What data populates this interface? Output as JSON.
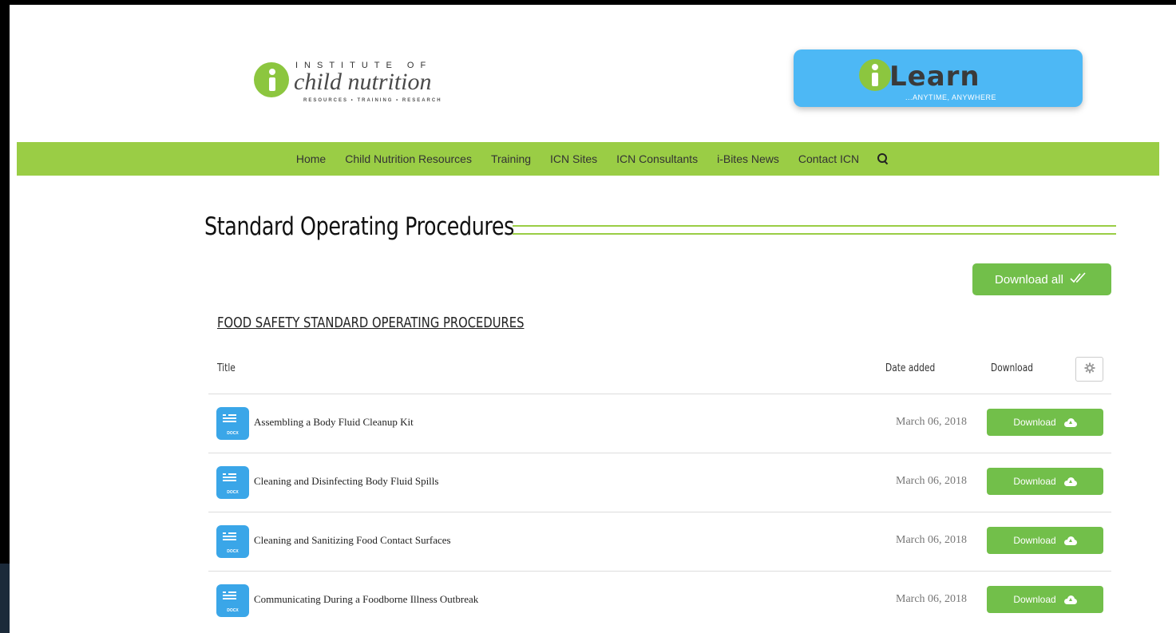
{
  "header": {
    "logo": {
      "top_text": "INSTITUTE OF",
      "script_text": "child nutrition",
      "tagline": "RESOURCES • TRAINING • RESEARCH"
    },
    "ilearn": {
      "word": "Learn",
      "sub": "...ANYTIME, ANYWHERE",
      "color": "#4db8f5"
    }
  },
  "nav": {
    "items": [
      "Home",
      "Child Nutrition Resources",
      "Training",
      "ICN Sites",
      "ICN Consultants",
      "i-Bites News",
      "Contact ICN"
    ],
    "color": "#9acd45"
  },
  "page": {
    "title": "Standard Operating Procedures",
    "download_all_label": "Download all",
    "section_title": "FOOD SAFETY STANDARD OPERATING PROCEDURES"
  },
  "table": {
    "headers": {
      "title": "Title",
      "date": "Date added",
      "download": "Download"
    },
    "rows": [
      {
        "name": "Assembling a Body Fluid Cleanup Kit",
        "date": "March 06, 2018",
        "button": "Download",
        "ext": "DOCX"
      },
      {
        "name": "Cleaning and Disinfecting Body Fluid Spills",
        "date": "March 06, 2018",
        "button": "Download",
        "ext": "DOCX"
      },
      {
        "name": "Cleaning and Sanitizing Food Contact Surfaces",
        "date": "March 06, 2018",
        "button": "Download",
        "ext": "DOCX"
      },
      {
        "name": "Communicating During a Foodborne Illness Outbreak",
        "date": "March 06, 2018",
        "button": "Download",
        "ext": "DOCX"
      }
    ]
  },
  "colors": {
    "accent_green": "#72bf4a",
    "file_icon_blue": "#3aa6e8"
  }
}
